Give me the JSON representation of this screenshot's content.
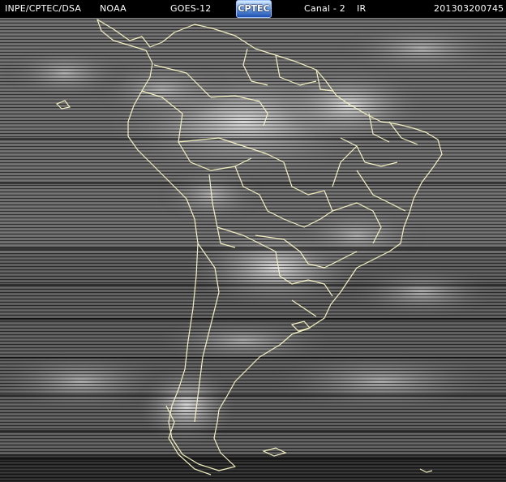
{
  "header": {
    "org": "INPE/CPTEC/DSA",
    "agency": "NOAA",
    "satellite": "GOES-12",
    "logo_text": "CPTEC",
    "channel": "Canal - 2",
    "band": "IR",
    "datetime": "201303200745"
  },
  "map": {
    "region": "South America",
    "border_color": "#f2f0c0",
    "background_color": "#000000"
  }
}
